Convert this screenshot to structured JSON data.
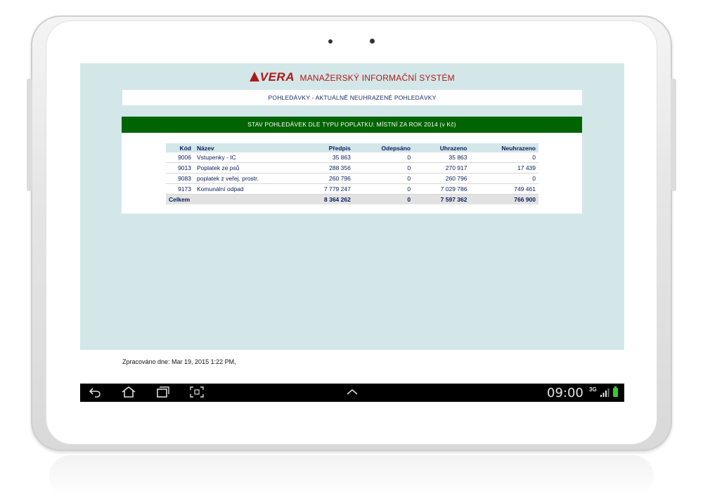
{
  "app": {
    "logo_text": "VERA",
    "title": "MANAŽERSKÝ INFORMAČNÍ SYSTÉM"
  },
  "subtitle": "POHLEDÁVKY  -  AKTUÁLNĚ NEUHRAZENÉ POHLEDÁVKY",
  "panel": {
    "heading": "STAV POHLEDÁVEK DLE TYPU POPLATKU:  MÍSTNÍ  ZA ROK  2014  (v Kč)"
  },
  "table": {
    "columns": [
      "Kód",
      "Název",
      "Předpis",
      "Odepsáno",
      "Uhrazeno",
      "Neuhrazeno"
    ],
    "rows": [
      [
        "9006",
        "Vstupenky  - IC",
        "35 863",
        "0",
        "35 863",
        "0"
      ],
      [
        "9013",
        "Poplatek ze psů",
        "288 356",
        "0",
        "270 917",
        "17 439"
      ],
      [
        "9083",
        "poplatek z veřej. prostr.",
        "260 796",
        "0",
        "260 796",
        "0"
      ],
      [
        "9173",
        "Komunální odpad",
        "7 779 247",
        "0",
        "7 029 786",
        "749 461"
      ]
    ],
    "total": [
      "Celkem",
      "",
      "8 364 262",
      "0",
      "7 597 362",
      "766 900"
    ]
  },
  "footer": {
    "processed": "Zpracováno dne: Mar 19, 2015 1:22 PM,"
  },
  "statusbar": {
    "time": "09:00",
    "network": "3G",
    "icons": [
      "back-icon",
      "home-icon",
      "recent-apps-icon",
      "screenshot-icon",
      "up-chevron-icon",
      "signal-icon",
      "battery-icon"
    ]
  },
  "colors": {
    "brand_red": "#b01818",
    "header_green": "#006400",
    "screen_bg": "#d3e7e9",
    "text_navy": "#0a1a5a"
  }
}
